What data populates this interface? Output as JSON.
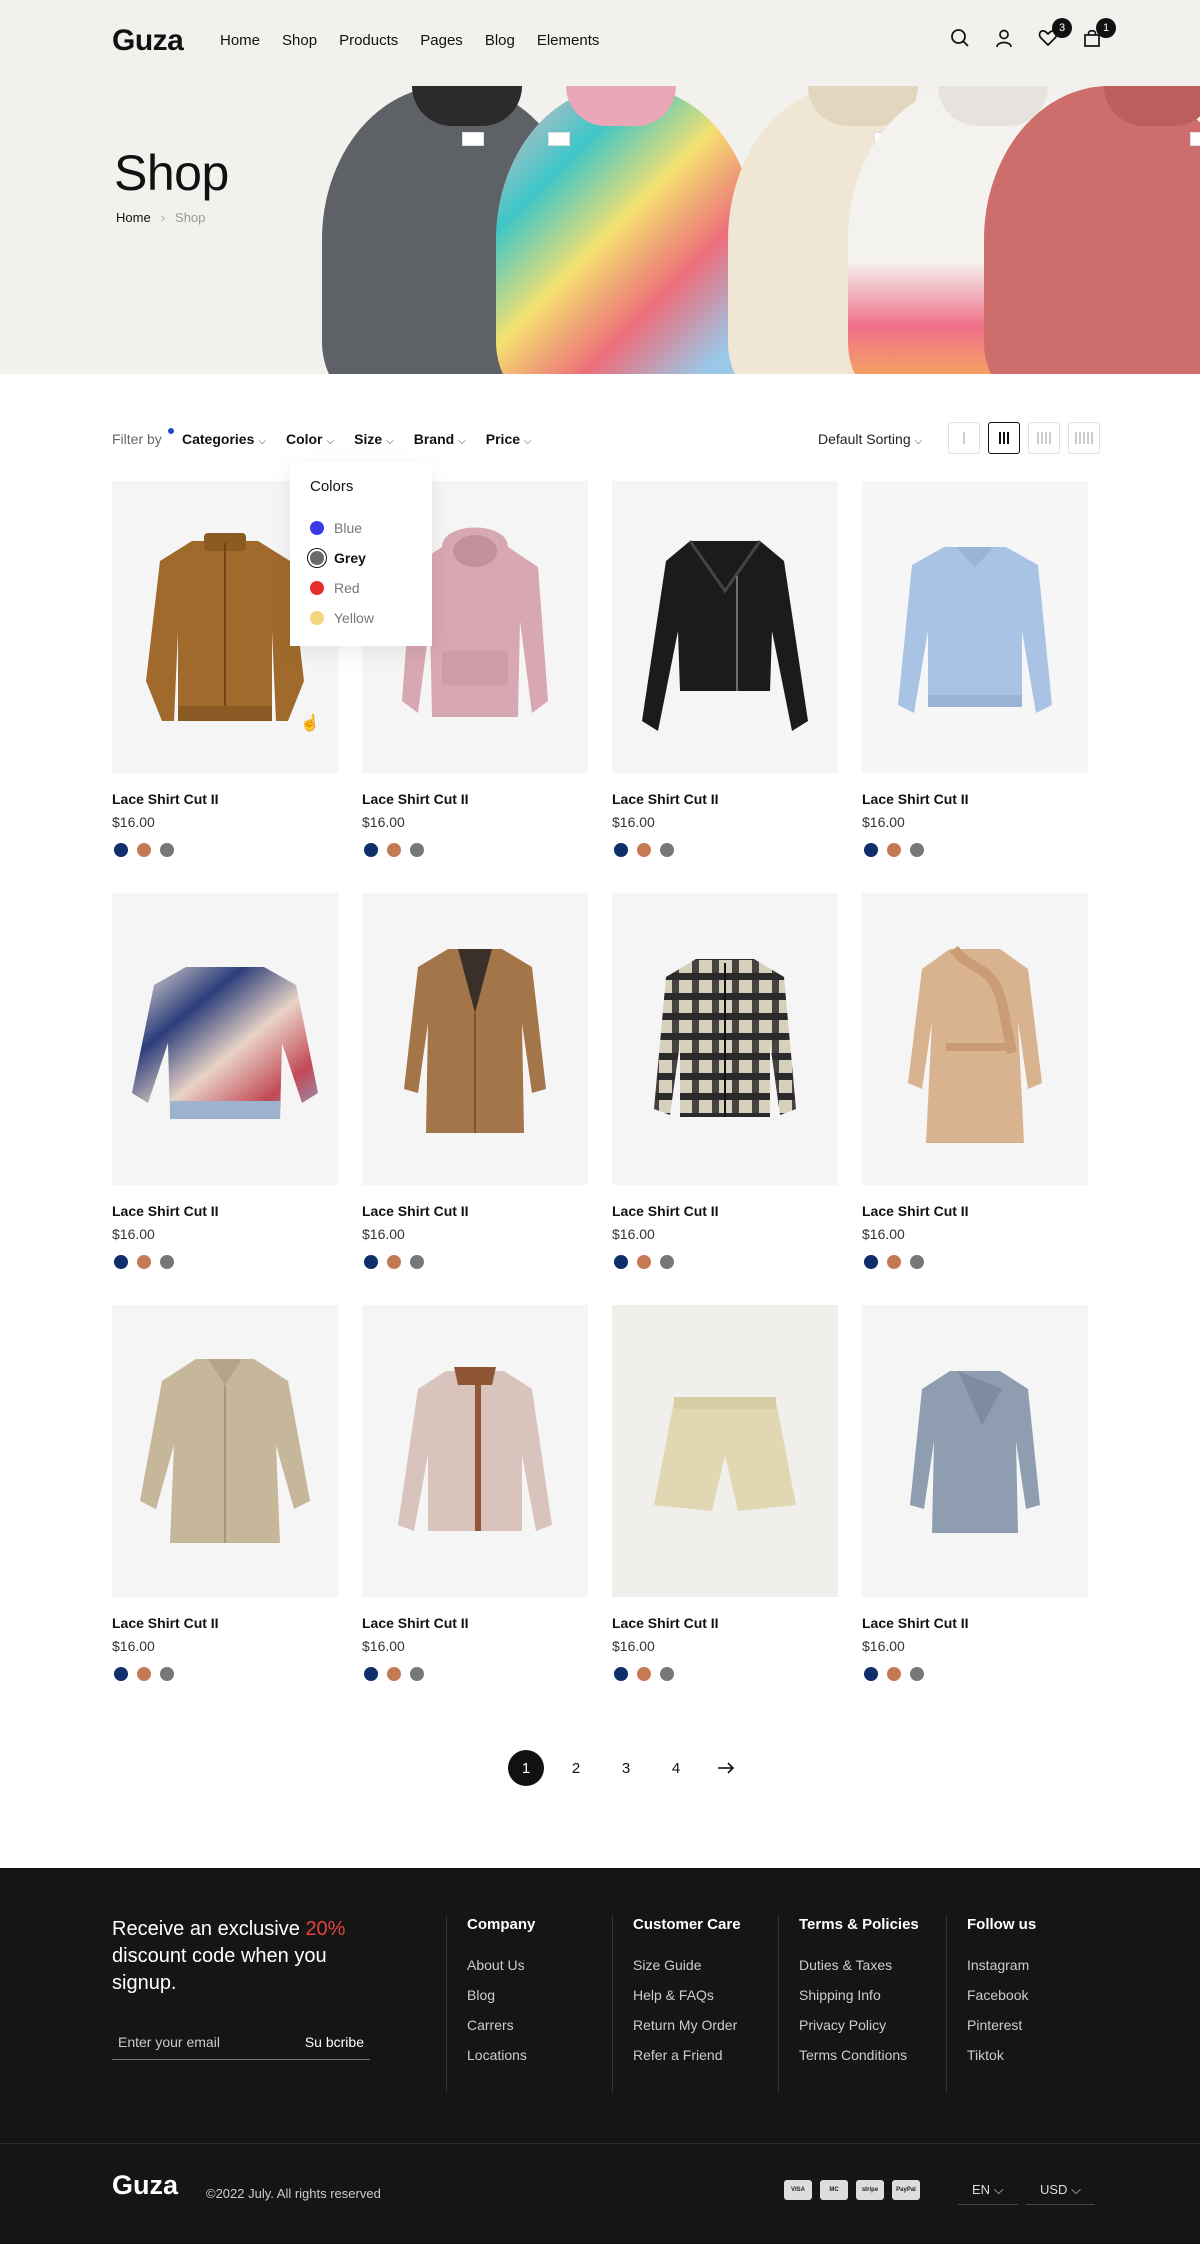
{
  "header": {
    "logo": "Guza",
    "nav": [
      "Home",
      "Shop",
      "Products",
      "Pages",
      "Blog",
      "Elements"
    ],
    "wishlist_count": "3",
    "cart_count": "1"
  },
  "hero": {
    "title": "Shop",
    "breadcrumb": [
      "Home",
      "Shop"
    ]
  },
  "filters": {
    "label": "Filter by",
    "items": [
      "Categories",
      "Color",
      "Size",
      "Brand",
      "Price"
    ],
    "sort": "Default Sorting"
  },
  "color_dropdown": {
    "title": "Colors",
    "options": [
      {
        "label": "Blue",
        "color": "#3a3ae8"
      },
      {
        "label": "Grey",
        "color": "#6a6a6a"
      },
      {
        "label": "Red",
        "color": "#e62e2e"
      },
      {
        "label": "Yellow",
        "color": "#f5d580"
      }
    ],
    "selected": "Grey"
  },
  "products": [
    {
      "name": "Lace Shirt Cut II",
      "price": "$16.00"
    },
    {
      "name": "Lace Shirt Cut II",
      "price": "$16.00"
    },
    {
      "name": "Lace Shirt Cut II",
      "price": "$16.00"
    },
    {
      "name": "Lace Shirt Cut II",
      "price": "$16.00"
    },
    {
      "name": "Lace Shirt Cut II",
      "price": "$16.00"
    },
    {
      "name": "Lace Shirt Cut II",
      "price": "$16.00"
    },
    {
      "name": "Lace Shirt Cut II",
      "price": "$16.00"
    },
    {
      "name": "Lace Shirt Cut II",
      "price": "$16.00"
    },
    {
      "name": "Lace Shirt Cut II",
      "price": "$16.00"
    },
    {
      "name": "Lace Shirt Cut II",
      "price": "$16.00"
    },
    {
      "name": "Lace Shirt Cut II",
      "price": "$16.00"
    },
    {
      "name": "Lace Shirt Cut II",
      "price": "$16.00"
    }
  ],
  "swatch_colors": [
    "#0e2f6b",
    "#c47b55",
    "#777777"
  ],
  "pagination": {
    "pages": [
      "1",
      "2",
      "3",
      "4"
    ],
    "active": "1"
  },
  "footer": {
    "promo_pre": "Receive an exclusive ",
    "promo_accent": "20%",
    "promo_post": " discount code when you signup.",
    "email_placeholder": "Enter your email",
    "subscribe": "Su bcribe",
    "columns": [
      {
        "title": "Company",
        "links": [
          "About Us",
          "Blog",
          "Carrers",
          "Locations"
        ]
      },
      {
        "title": "Customer Care",
        "links": [
          "Size Guide",
          "Help & FAQs",
          "Return My Order",
          "Refer a Friend"
        ]
      },
      {
        "title": "Terms & Policies",
        "links": [
          "Duties & Taxes",
          "Shipping Info",
          "Privacy Policy",
          "Terms Conditions"
        ]
      },
      {
        "title": "Follow us",
        "links": [
          "Instagram",
          "Facebook",
          "Pinterest",
          "Tiktok"
        ]
      }
    ],
    "logo": "Guza",
    "copyright": "©2022 July. All rights reserved",
    "payments": [
      "VISA",
      "MC",
      "stripe",
      "PayPal"
    ],
    "language": "EN",
    "currency": "USD"
  }
}
